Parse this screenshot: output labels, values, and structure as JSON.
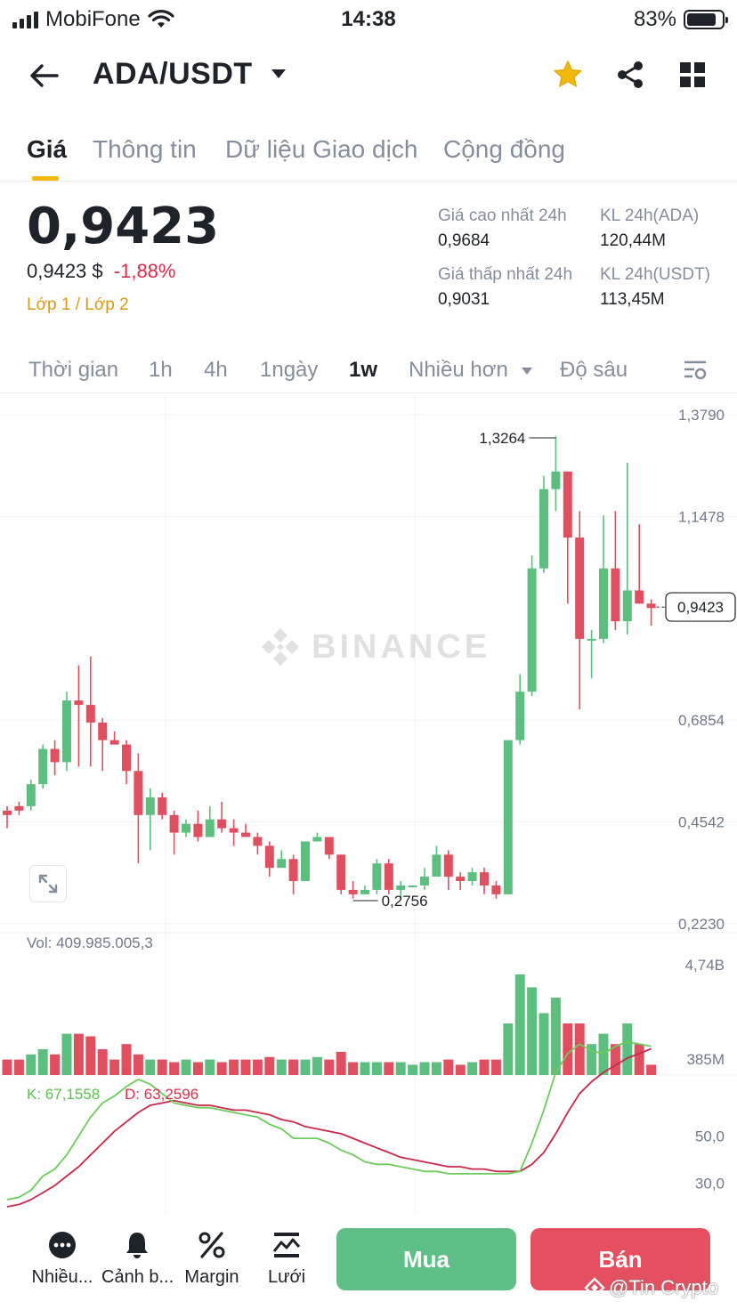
{
  "status_bar": {
    "carrier": "MobiFone",
    "time": "14:38",
    "battery": "83%",
    "battery_level": 0.83
  },
  "header": {
    "pair": "ADA/USDT",
    "favorite": true
  },
  "tabs": [
    {
      "label": "Giá",
      "active": true
    },
    {
      "label": "Thông tin",
      "active": false
    },
    {
      "label": "Dữ liệu Giao dịch",
      "active": false
    },
    {
      "label": "Cộng đồng",
      "active": false
    }
  ],
  "price": {
    "last": "0,9423",
    "fiat": "0,9423 $",
    "change": "-1,88%",
    "tag": "Lớp 1 / Lớp 2"
  },
  "stats": {
    "high_label": "Giá cao nhất 24h",
    "high_value": "0,9684",
    "low_label": "Giá thấp nhất 24h",
    "low_value": "0,9031",
    "vol_base_label": "KL 24h(ADA)",
    "vol_base_value": "120,44M",
    "vol_quote_label": "KL 24h(USDT)",
    "vol_quote_value": "113,45M"
  },
  "intervals": [
    {
      "label": "Thời gian",
      "active": false
    },
    {
      "label": "1h",
      "active": false
    },
    {
      "label": "4h",
      "active": false
    },
    {
      "label": "1ngày",
      "active": false
    },
    {
      "label": "1w",
      "active": true
    },
    {
      "label": "Nhiều hơn",
      "active": false
    },
    {
      "label": "Độ sâu",
      "active": false
    }
  ],
  "chart": {
    "watermark": "BINANCE",
    "volume_label": "Vol: 409.985.005,3",
    "kd_k": "K: 67,1558",
    "kd_d": "D: 63,2596",
    "colors": {
      "up": "#5cbf7f",
      "down": "#e04f5f",
      "k_line": "#6ccc5a",
      "d_line": "#c8284a"
    }
  },
  "chart_data": {
    "type": "candlestick",
    "price_axis": [
      "1,3790",
      "1,1478",
      "0,6854",
      "0,4542",
      "0,2230"
    ],
    "volume_axis": [
      "4,74B",
      "385M"
    ],
    "kd_axis": [
      "50,0",
      "30,0"
    ],
    "max_label": "1,3264",
    "min_label": "0,2756",
    "current_price_label": "0,9423",
    "candles": [
      [
        0.48,
        0.47,
        0.49,
        0.44
      ],
      [
        0.49,
        0.48,
        0.5,
        0.47
      ],
      [
        0.49,
        0.54,
        0.55,
        0.48
      ],
      [
        0.54,
        0.62,
        0.63,
        0.53
      ],
      [
        0.62,
        0.59,
        0.64,
        0.56
      ],
      [
        0.59,
        0.73,
        0.75,
        0.57
      ],
      [
        0.73,
        0.72,
        0.81,
        0.58
      ],
      [
        0.72,
        0.68,
        0.83,
        0.58
      ],
      [
        0.68,
        0.64,
        0.69,
        0.57
      ],
      [
        0.64,
        0.63,
        0.66,
        0.63
      ],
      [
        0.63,
        0.57,
        0.64,
        0.54
      ],
      [
        0.57,
        0.47,
        0.61,
        0.36
      ],
      [
        0.47,
        0.51,
        0.53,
        0.39
      ],
      [
        0.51,
        0.47,
        0.52,
        0.46
      ],
      [
        0.47,
        0.43,
        0.48,
        0.38
      ],
      [
        0.43,
        0.45,
        0.46,
        0.42
      ],
      [
        0.45,
        0.42,
        0.48,
        0.41
      ],
      [
        0.42,
        0.46,
        0.49,
        0.42
      ],
      [
        0.46,
        0.44,
        0.5,
        0.43
      ],
      [
        0.44,
        0.43,
        0.46,
        0.4
      ],
      [
        0.43,
        0.42,
        0.45,
        0.42
      ],
      [
        0.42,
        0.4,
        0.43,
        0.38
      ],
      [
        0.4,
        0.35,
        0.41,
        0.33
      ],
      [
        0.35,
        0.37,
        0.39,
        0.35
      ],
      [
        0.37,
        0.32,
        0.38,
        0.29
      ],
      [
        0.32,
        0.41,
        0.41,
        0.32
      ],
      [
        0.41,
        0.42,
        0.43,
        0.41
      ],
      [
        0.42,
        0.38,
        0.42,
        0.37
      ],
      [
        0.38,
        0.3,
        0.38,
        0.29
      ],
      [
        0.3,
        0.29,
        0.32,
        0.28
      ],
      [
        0.29,
        0.3,
        0.31,
        0.29
      ],
      [
        0.3,
        0.36,
        0.37,
        0.29
      ],
      [
        0.36,
        0.3,
        0.37,
        0.29
      ],
      [
        0.3,
        0.31,
        0.32,
        0.28
      ],
      [
        0.31,
        0.31,
        0.31,
        0.31
      ],
      [
        0.31,
        0.33,
        0.35,
        0.3
      ],
      [
        0.33,
        0.38,
        0.4,
        0.33
      ],
      [
        0.38,
        0.33,
        0.39,
        0.3
      ],
      [
        0.33,
        0.32,
        0.34,
        0.3
      ],
      [
        0.32,
        0.34,
        0.35,
        0.31
      ],
      [
        0.34,
        0.31,
        0.35,
        0.29
      ],
      [
        0.31,
        0.29,
        0.32,
        0.28
      ],
      [
        0.29,
        0.64,
        0.64,
        0.29
      ],
      [
        0.64,
        0.75,
        0.79,
        0.63
      ],
      [
        0.75,
        1.03,
        1.06,
        0.74
      ],
      [
        1.03,
        1.21,
        1.24,
        1.02
      ],
      [
        1.21,
        1.25,
        1.33,
        1.16
      ],
      [
        1.25,
        1.1,
        1.25,
        0.95
      ],
      [
        1.1,
        0.87,
        1.16,
        0.71
      ],
      [
        0.87,
        0.87,
        0.89,
        0.78
      ],
      [
        0.87,
        1.03,
        1.15,
        0.86
      ],
      [
        1.03,
        0.91,
        1.16,
        0.89
      ],
      [
        0.91,
        0.98,
        1.27,
        0.88
      ],
      [
        0.98,
        0.95,
        1.13,
        0.95
      ],
      [
        0.95,
        0.94,
        0.96,
        0.9
      ]
    ],
    "volumes": [
      0.3,
      0.3,
      0.4,
      0.5,
      0.4,
      0.8,
      0.8,
      0.75,
      0.5,
      0.3,
      0.6,
      0.4,
      0.3,
      0.3,
      0.25,
      0.3,
      0.25,
      0.3,
      0.25,
      0.3,
      0.3,
      0.3,
      0.35,
      0.3,
      0.3,
      0.3,
      0.35,
      0.3,
      0.45,
      0.25,
      0.25,
      0.25,
      0.25,
      0.25,
      0.2,
      0.25,
      0.25,
      0.3,
      0.2,
      0.25,
      0.3,
      0.3,
      1.0,
      1.95,
      1.7,
      1.2,
      1.5,
      1.0,
      1.0,
      0.6,
      0.8,
      0.6,
      1.0,
      0.6,
      0.2
    ],
    "k_line": [
      23,
      24,
      27,
      33,
      36,
      42,
      50,
      58,
      64,
      67,
      71,
      74,
      72,
      68,
      64,
      63,
      62,
      62,
      61,
      60,
      59,
      58,
      55,
      53,
      49,
      49,
      49,
      47,
      44,
      42,
      39,
      38,
      38,
      37,
      36,
      35,
      35,
      34,
      34,
      34,
      34,
      34,
      34,
      35,
      47,
      61,
      77,
      85,
      89,
      86,
      85,
      88,
      90,
      89,
      88
    ],
    "d_line": [
      20,
      21,
      23,
      26,
      29,
      33,
      37,
      42,
      47,
      52,
      56,
      60,
      63,
      64,
      65,
      64,
      63,
      63,
      62,
      61,
      61,
      60,
      59,
      57,
      56,
      54,
      53,
      52,
      51,
      49,
      47,
      45,
      43,
      41,
      40,
      39,
      38,
      37,
      37,
      36,
      36,
      35,
      35,
      35,
      38,
      43,
      51,
      60,
      68,
      73,
      77,
      80,
      83,
      85,
      87
    ]
  },
  "bottom_nav": [
    {
      "label": "Nhiều...",
      "icon": "more-icon"
    },
    {
      "label": "Cảnh b...",
      "icon": "bell-icon"
    },
    {
      "label": "Margin",
      "icon": "percent-icon"
    },
    {
      "label": "Lưới",
      "icon": "grid-bot-icon"
    }
  ],
  "actions": {
    "buy": "Mua",
    "sell": "Bán"
  },
  "credit": "@Tin Crypto"
}
